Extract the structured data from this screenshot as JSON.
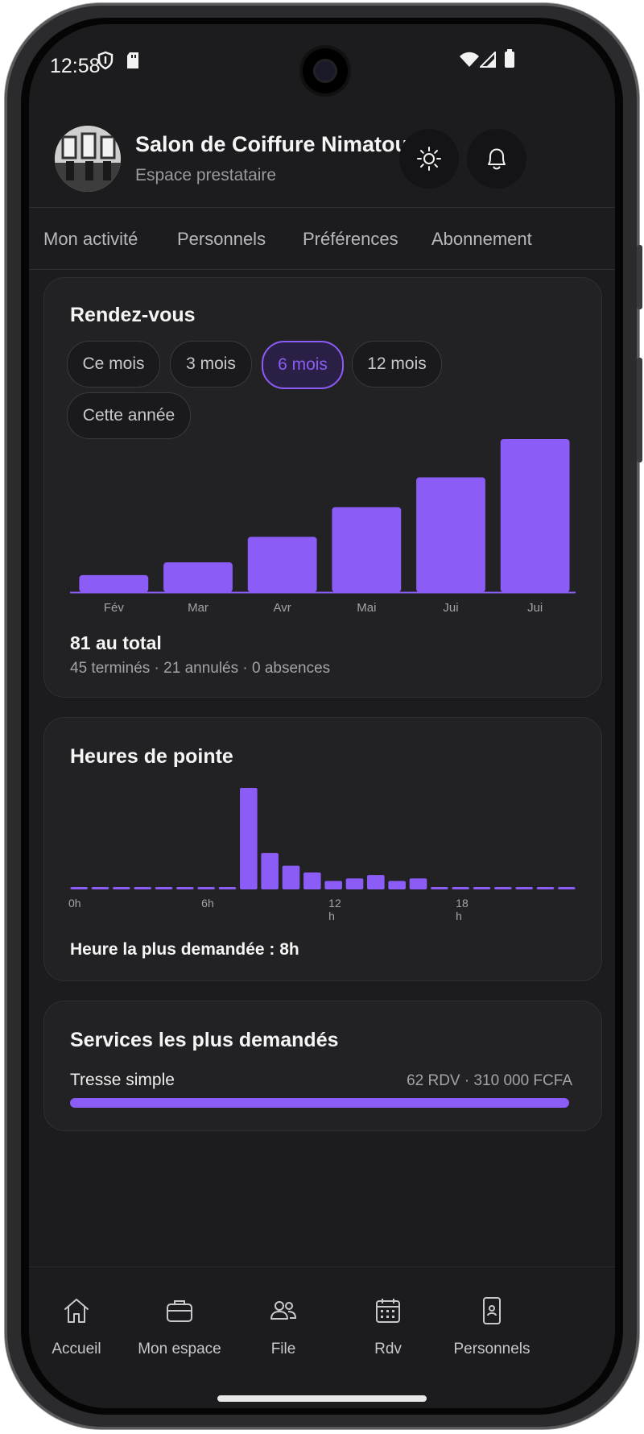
{
  "status_bar": {
    "time": "12:58"
  },
  "header": {
    "title": "Salon de Coiffure Nimatou",
    "subtitle": "Espace prestataire"
  },
  "tabs": [
    {
      "label": "Mon activité"
    },
    {
      "label": "Personnels"
    },
    {
      "label": "Préférences"
    },
    {
      "label": "Abonnement"
    }
  ],
  "appointments": {
    "title": "Rendez-vous",
    "filters": [
      {
        "label": "Ce mois",
        "active": false
      },
      {
        "label": "3 mois",
        "active": false
      },
      {
        "label": "6 mois",
        "active": true
      },
      {
        "label": "12 mois",
        "active": false
      },
      {
        "label": "Cette année",
        "active": false
      }
    ],
    "total_label": "81 au total",
    "breakdown_label": "45 terminés · 21 annulés · 0 absences"
  },
  "peak_hours": {
    "title": "Heures de pointe",
    "summary": "Heure la plus demandée : 8h"
  },
  "services": {
    "title": "Services les plus demandés",
    "items": [
      {
        "name": "Tresse simple",
        "meta": "62 RDV · 310 000 FCFA",
        "fraction": 1.0
      }
    ]
  },
  "bottom_nav": [
    {
      "label": "Accueil",
      "icon": "home-icon"
    },
    {
      "label": "Mon espace",
      "icon": "briefcase-icon"
    },
    {
      "label": "File",
      "icon": "people-icon"
    },
    {
      "label": "Rdv",
      "icon": "calendar-icon"
    },
    {
      "label": "Personnels",
      "icon": "phone-badge-icon"
    }
  ],
  "colors": {
    "accent": "#8b5cf6",
    "background": "#1c1c1e",
    "card": "#222224"
  },
  "chart_data": [
    {
      "type": "bar",
      "categories": [
        "Fév",
        "Mar",
        "Avr",
        "Mai",
        "Jui",
        "Jui"
      ],
      "values": [
        4,
        7,
        13,
        20,
        27,
        36
      ],
      "title": "Rendez-vous",
      "xlabel": "",
      "ylabel": "",
      "grid": false
    },
    {
      "type": "bar",
      "categories": [
        "0h",
        "1h",
        "2h",
        "3h",
        "4h",
        "5h",
        "6h",
        "7h",
        "8h",
        "9h",
        "10h",
        "11h",
        "12h",
        "13h",
        "14h",
        "15h",
        "16h",
        "17h",
        "18h",
        "19h",
        "20h",
        "21h",
        "22h",
        "23h"
      ],
      "values": [
        0,
        0,
        0,
        0,
        0,
        0,
        0.2,
        0,
        12,
        4.3,
        2.8,
        2,
        1,
        1.3,
        1.7,
        1,
        1.3,
        0,
        0,
        0,
        0,
        0,
        0.2,
        0
      ],
      "tick_labels": [
        "0h",
        "6h",
        "12\nh",
        "18\nh"
      ],
      "title": "Heures de pointe",
      "xlabel": "",
      "ylabel": "",
      "grid": false
    }
  ]
}
